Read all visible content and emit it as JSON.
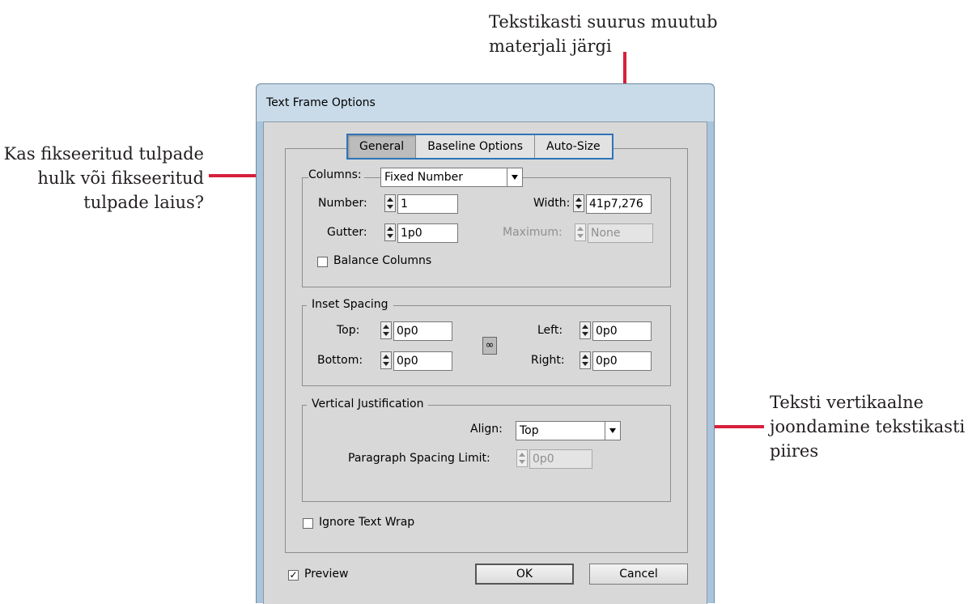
{
  "callouts": {
    "top": [
      "Tekstikasti suurus muutub",
      "materjali järgi"
    ],
    "left": [
      "Kas fikseeritud tulpade",
      "hulk või fikseeritud",
      "tulpade laius?"
    ],
    "right": [
      "Teksti vertikaalne",
      "joondamine tekstikasti",
      "piires"
    ]
  },
  "dialog": {
    "title": "Text Frame Options",
    "tabs": [
      "General",
      "Baseline Options",
      "Auto-Size"
    ],
    "active_tab": "General",
    "columns": {
      "label": "Columns:",
      "select_value": "Fixed Number",
      "number_label": "Number:",
      "number_value": "1",
      "width_label": "Width:",
      "width_value": "41p7,276",
      "gutter_label": "Gutter:",
      "gutter_value": "1p0",
      "maximum_label": "Maximum:",
      "maximum_value": "None",
      "balance_label": "Balance Columns",
      "balance_checked": false
    },
    "inset": {
      "label": "Inset Spacing",
      "top_label": "Top:",
      "top_value": "0p0",
      "bottom_label": "Bottom:",
      "bottom_value": "0p0",
      "left_label": "Left:",
      "left_value": "0p0",
      "right_label": "Right:",
      "right_value": "0p0",
      "link_icon": "chain-link-icon"
    },
    "vertical": {
      "label": "Vertical Justification",
      "align_label": "Align:",
      "align_value": "Top",
      "spacing_label": "Paragraph Spacing Limit:",
      "spacing_value": "0p0"
    },
    "ignore_wrap_label": "Ignore Text Wrap",
    "ignore_wrap_checked": false,
    "preview_label": "Preview",
    "preview_checked": true,
    "ok_label": "OK",
    "cancel_label": "Cancel"
  },
  "colors": {
    "callout_red": "#d71f3b",
    "tab_highlight": "#2f74b8"
  }
}
